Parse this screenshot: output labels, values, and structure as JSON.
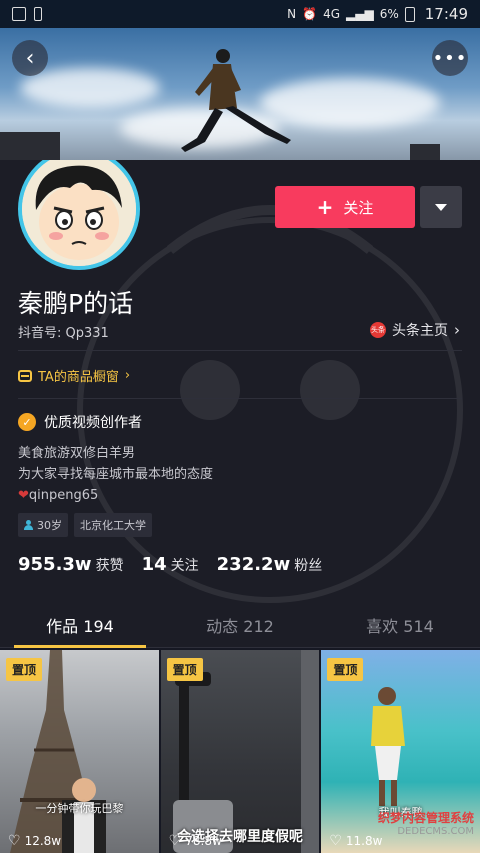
{
  "status_bar": {
    "network": "4G",
    "battery": "6%",
    "time": "17:49"
  },
  "profile": {
    "name": "秦鹏P的话",
    "douyin_id": "抖音号: Qp331",
    "toutiao_label": "头条主页",
    "toutiao_logo": "头条",
    "follow_label": "关注",
    "shop_label": "TA的商品橱窗",
    "creator_label": "优质视频创作者",
    "bio": [
      "美食旅游双修白羊男",
      "为大家寻找每座城市最本地的态度",
      "qinpeng65"
    ],
    "tags": [
      "30岁",
      "北京化工大学"
    ],
    "stats": {
      "likes_value": "955.3w",
      "likes_label": "获赞",
      "following_value": "14",
      "following_label": "关注",
      "followers_value": "232.2w",
      "followers_label": "粉丝"
    }
  },
  "tabs": [
    {
      "label": "作品 194"
    },
    {
      "label": "动态 212"
    },
    {
      "label": "喜欢 514"
    }
  ],
  "videos": [
    {
      "pin": "置顶",
      "caption": "一分钟带你玩巴黎",
      "likes": "12.8w"
    },
    {
      "pin": "置顶",
      "caption": "会选择去哪里度假呢",
      "likes": "78.8w"
    },
    {
      "pin": "置顶",
      "caption": "我叫秦鹏",
      "likes": "11.8w"
    }
  ],
  "watermark": {
    "line1": "织梦内容管理系统",
    "line2": "DEDECMS.COM"
  },
  "colors": {
    "accent_follow": "#f83b5e",
    "accent_yellow": "#f6c544",
    "avatar_ring": "#43c5e8",
    "background": "#161823"
  }
}
